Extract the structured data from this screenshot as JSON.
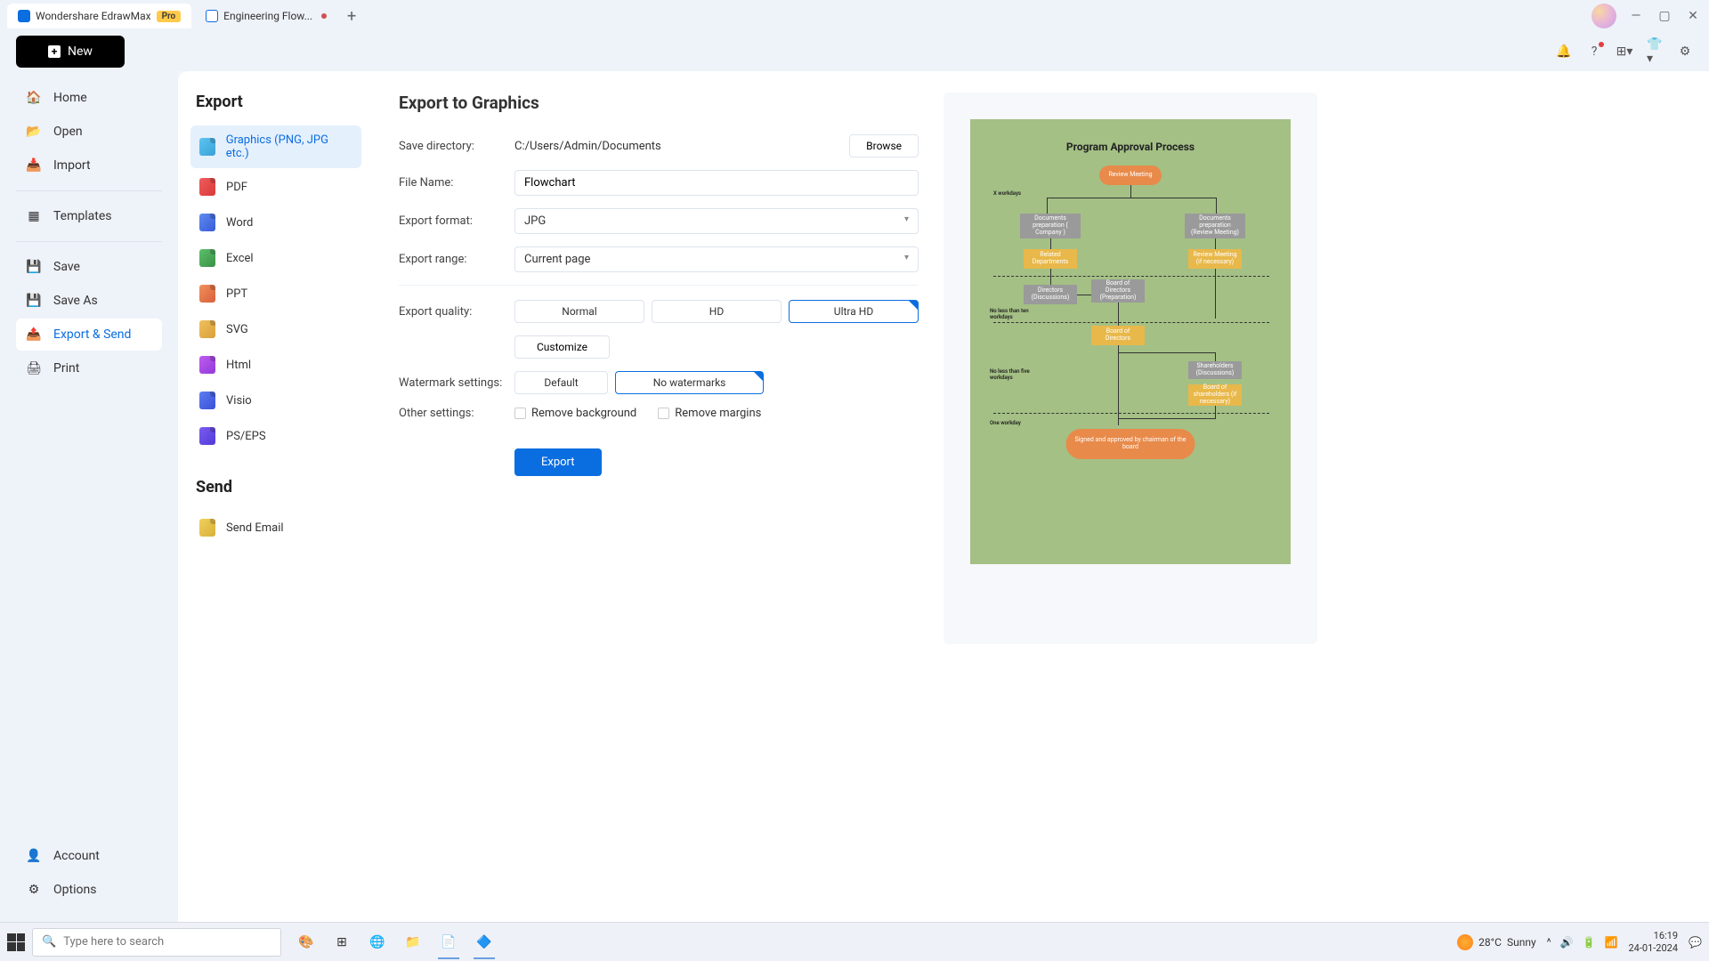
{
  "titlebar": {
    "tabs": [
      {
        "label": "Wondershare EdrawMax",
        "badge": "Pro"
      },
      {
        "label": "Engineering Flow..."
      }
    ]
  },
  "toprow": {
    "new_label": "New"
  },
  "nav": {
    "home": "Home",
    "open": "Open",
    "import": "Import",
    "templates": "Templates",
    "save": "Save",
    "save_as": "Save As",
    "export_send": "Export & Send",
    "print": "Print",
    "account": "Account",
    "options": "Options"
  },
  "export_list": {
    "title": "Export",
    "items": {
      "graphics": "Graphics (PNG, JPG etc.)",
      "pdf": "PDF",
      "word": "Word",
      "excel": "Excel",
      "ppt": "PPT",
      "svg": "SVG",
      "html": "Html",
      "visio": "Visio",
      "ps": "PS/EPS"
    },
    "send_title": "Send",
    "send_email": "Send Email"
  },
  "form": {
    "title": "Export to Graphics",
    "save_dir_label": "Save directory:",
    "save_dir_value": "C:/Users/Admin/Documents",
    "browse": "Browse",
    "filename_label": "File Name:",
    "filename_value": "Flowchart",
    "format_label": "Export format:",
    "format_value": "JPG",
    "range_label": "Export range:",
    "range_value": "Current page",
    "quality_label": "Export quality:",
    "quality_normal": "Normal",
    "quality_hd": "HD",
    "quality_ultra": "Ultra HD",
    "customize": "Customize",
    "watermark_label": "Watermark settings:",
    "watermark_default": "Default",
    "watermark_none": "No watermarks",
    "other_label": "Other settings:",
    "remove_bg": "Remove background",
    "remove_margins": "Remove margins",
    "export_btn": "Export"
  },
  "preview": {
    "title": "Program Approval Process",
    "n_review": "Review Meeting",
    "x_workdays": "X workdays",
    "n_doc_company": "Documents preparation ( Company )",
    "n_doc_review": "Documents preparation (Review Meeting)",
    "n_related": "Related Departments",
    "n_review2": "Review Meeting (if necessary)",
    "n_directors_disc": "Directors (Discussions)",
    "n_board_prep": "Board of Directors (Preparation)",
    "no_less_ten": "No less than ten workdays",
    "n_board": "Board of Directors",
    "n_shareh_disc": "Shareholders (Discussions)",
    "no_less_five": "No less than five workdays",
    "n_board_shareh": "Board of shareholders (if necessary)",
    "one_workday": "One workday",
    "n_signed": "Signed and approved by chairman of the board"
  },
  "taskbar": {
    "search_placeholder": "Type here to search",
    "temp": "28°C",
    "weather": "Sunny",
    "time": "16:19",
    "date": "24-01-2024"
  }
}
